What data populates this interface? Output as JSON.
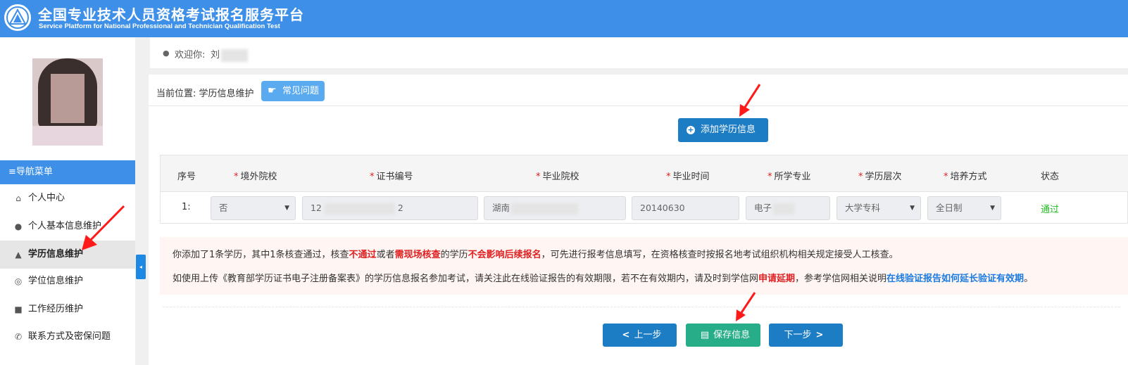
{
  "header": {
    "title_cn": "全国专业技术人员资格考试报名服务平台",
    "title_en": "Service Platform for National Professional and Technician Qualification Test"
  },
  "sidebar": {
    "nav_title": "≡导航菜单",
    "items": [
      {
        "label": "个人中心",
        "icon": "home-icon"
      },
      {
        "label": "个人基本信息维护",
        "icon": "user-icon"
      },
      {
        "label": "学历信息维护",
        "icon": "graduation-cap-icon"
      },
      {
        "label": "学位信息维护",
        "icon": "medal-icon"
      },
      {
        "label": "工作经历维护",
        "icon": "briefcase-icon"
      },
      {
        "label": "联系方式及密保问题",
        "icon": "phone-icon"
      }
    ],
    "collapse": "◂"
  },
  "welcome": {
    "text": "欢迎你:",
    "name": "刘"
  },
  "breadcrumb": "当前位置: 学历信息维护",
  "faq_button": "常见问题",
  "add_button": "添加学历信息",
  "table": {
    "headers": [
      "序号",
      "境外院校",
      "证书编号",
      "毕业院校",
      "毕业时间",
      "所学专业",
      "学历层次",
      "培养方式",
      "状态"
    ],
    "row": {
      "index": "1:",
      "overseas": "否",
      "cert_prefix": "12",
      "cert_suffix": "2",
      "school": "湖南",
      "grad_date": "20140630",
      "major": "电子",
      "level": "大学专科",
      "mode": "全日制",
      "status": "通过"
    }
  },
  "notice": {
    "line1": {
      "a": "你添加了1条学历，其中1条核查通过，核查",
      "b": "不通过",
      "c": "或者",
      "d": "需现场核查",
      "e": "的学历",
      "f": "不会影响后续报名",
      "g": "，可先进行报考信息填写，在资格核查时按报名地考试组织机构相关规定接受人工核查。"
    },
    "line2": {
      "a": "如使用上传《教育部学历证书电子注册备案表》的学历信息报名参加考试，请关注此在线验证报告的有效期限，若不在有效期内，请及时到学信网",
      "b": "申请延期",
      "c": "，参考学信网相关说明",
      "d": "在线验证报告如何延长验证有效期",
      "e": "。"
    }
  },
  "buttons": {
    "prev": "上一步",
    "save": "保存信息",
    "next": "下一步"
  },
  "colors": {
    "header": "#3d8fe8",
    "primary": "#1c7cc4",
    "save": "#27ae88",
    "pass": "#22bb22",
    "warning": "#e02020",
    "annotation_arrow": "#ff1a1a"
  }
}
